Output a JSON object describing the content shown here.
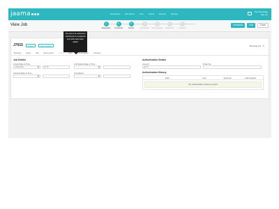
{
  "app": {
    "logo": "jaama"
  },
  "nav": {
    "items": [
      "Dashboard",
      "Jobs Board",
      "Jobs",
      "Assets",
      "Reports",
      "Settings"
    ],
    "user_name": "Tom Woodridge",
    "user_role": "Sign out"
  },
  "title": {
    "text": "View Job"
  },
  "stepper": {
    "steps": [
      {
        "num": "1",
        "label": "Requested",
        "active": true
      },
      {
        "num": "2",
        "label": "Confirmed",
        "active": true
      },
      {
        "num": "3",
        "label": "Arrived",
        "active": true
      },
      {
        "num": "4",
        "label": "Job Started",
        "active": false
      },
      {
        "num": "5",
        "label": "Job Complete",
        "active": false
      },
      {
        "num": "6",
        "label": "Authorised",
        "active": false
      },
      {
        "num": "7",
        "label": "Invoiced",
        "active": false
      }
    ]
  },
  "actions": {
    "feedback": "Feedback",
    "edit": "Edit",
    "close": "Close"
  },
  "job": {
    "id": "J7915",
    "badge_1": "Active",
    "badge_2": "Open Tooling",
    "showing": "Showing 1/1",
    "tooltip": "Job cannot be authorised until the job is completed and costs have been added"
  },
  "tabs": [
    "Booking",
    "Asset",
    "Job",
    "Documents",
    "Costs",
    "Auth",
    "Conversation",
    "Invoices"
  ],
  "job_details": {
    "title": "Job Details",
    "arrival_label": "Arrival Date & Time",
    "arrival_date": "21/04/2022",
    "arrival_time": "09:15",
    "start_label": "Job Started Date & Time",
    "start_date": "",
    "start_time": "",
    "end_label": "Job End Date & Time",
    "end_date": "",
    "end_time": "",
    "complete_label": "Completed",
    "complete_date": "",
    "complete_time": ""
  },
  "auth_details": {
    "title": "Authorisation Details",
    "amount_label": "Amount",
    "amount_value": "£0.00",
    "order_label": "Order No",
    "order_value": ""
  },
  "auth_history": {
    "title": "Authorisation History",
    "columns": [
      "Date",
      "User",
      "Approval",
      "Auth Applied"
    ],
    "empty": "No Authorisation History Found"
  }
}
